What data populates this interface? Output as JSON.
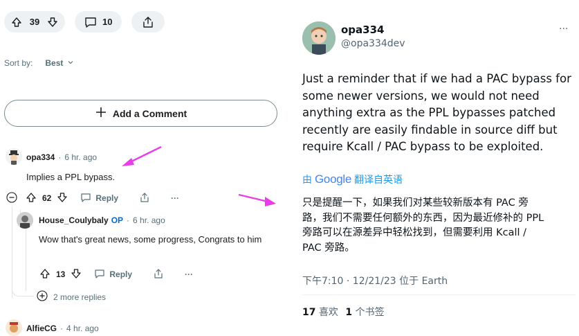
{
  "post_actions": {
    "upvotes": "39",
    "comments": "10"
  },
  "sort": {
    "label": "Sort by:",
    "value": "Best"
  },
  "add_comment": {
    "label": "Add a Comment"
  },
  "comments": [
    {
      "author": "opa334",
      "op": "",
      "time": "6 hr. ago",
      "body": "Implies a PPL bypass.",
      "score": "62",
      "reply": "Reply"
    },
    {
      "author": "House_Coulybaly",
      "op": "OP",
      "time": "6 hr. ago",
      "body": "Wow that's great news, some progress, Congrats to him",
      "score": "13",
      "reply": "Reply"
    },
    {
      "author": "AlfieCG",
      "op": "",
      "time": "4 hr. ago"
    }
  ],
  "more_replies": "2 more replies",
  "tweet": {
    "name": "opa334",
    "handle": "@opa334dev",
    "more": "···",
    "text_lines": [
      "Just a reminder that if we had a PAC bypass for",
      "some newer versions, we would not need",
      "anything extra as the PPL bypasses patched",
      "recently are easily findable in source diff but",
      "require Kcall / PAC bypass to be exploited."
    ],
    "translate_prefix": "由",
    "translate_brand": "Google",
    "translate_link": "翻译自英语",
    "translated_lines": [
      "只是提醒一下，如果我们对某些较新版本有 PAC 旁",
      "路，我们不需要任何额外的东西，因为最近修补的 PPL",
      "旁路可以在源差异中轻松找到，但需要利用 Kcall /",
      "PAC 旁路。"
    ],
    "timestamp": "下午7:10 · 12/21/23 位于 Earth",
    "likes_count": "17",
    "likes_label": "喜欢",
    "bookmarks_count": "1",
    "bookmarks_label": "个书签"
  },
  "colors": {
    "arrow": "#e83ee8",
    "link_blue": "#1d9bf0",
    "op_blue": "#0a66c2"
  }
}
